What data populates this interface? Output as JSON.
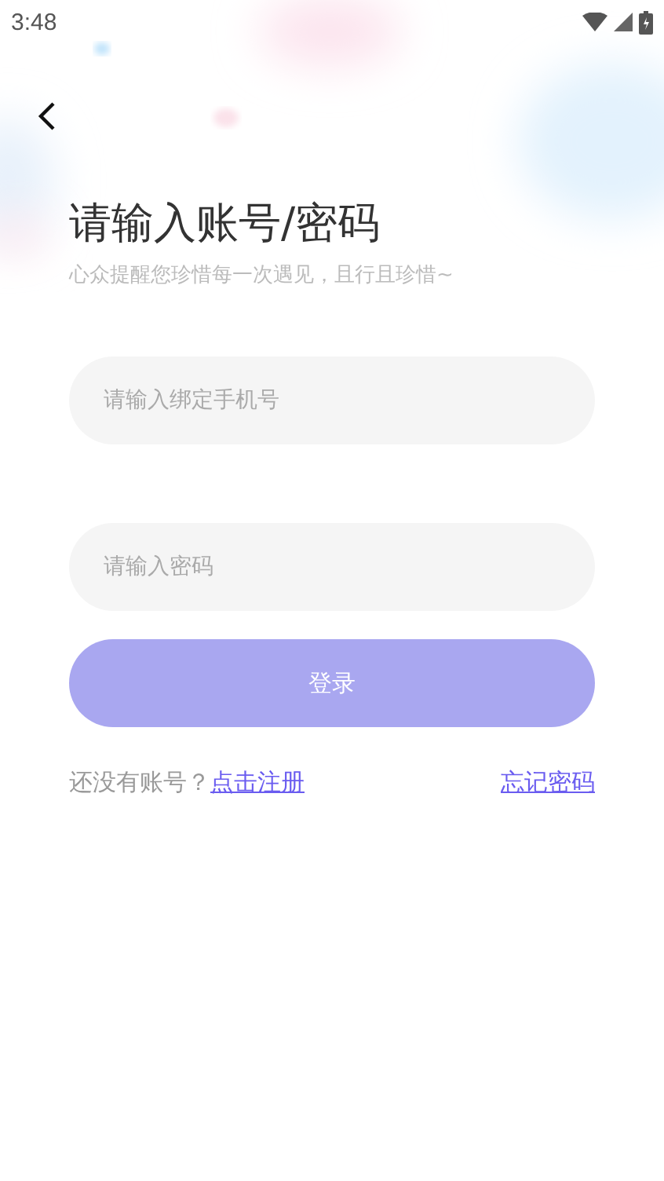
{
  "status_bar": {
    "time": "3:48"
  },
  "title": "请输入账号/密码",
  "subtitle": "心众提醒您珍惜每一次遇见，且行且珍惜~",
  "fields": [
    {
      "placeholder": "请输入绑定手机号"
    },
    {
      "placeholder": "请输入密码"
    }
  ],
  "login_button": {
    "label": "登录",
    "disabled": true
  },
  "register_prompt": "还没有账号？",
  "register_link": "点击注册",
  "forgot_link": "忘记密码"
}
